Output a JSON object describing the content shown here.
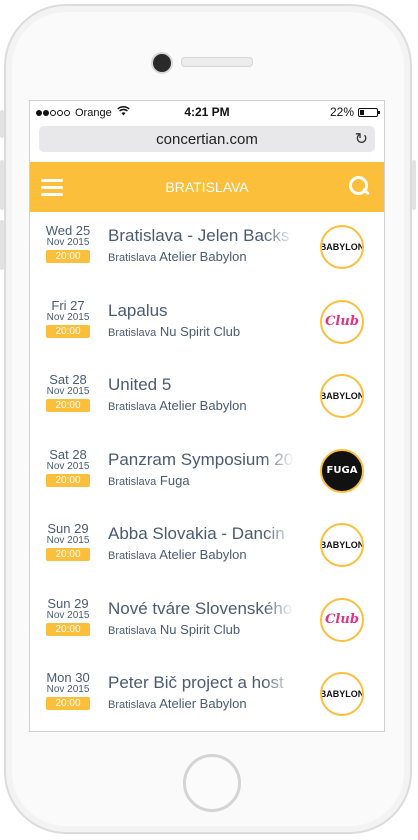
{
  "status_bar": {
    "carrier": "Orange",
    "time": "4:21 PM",
    "battery": "22%",
    "battery_level": 0.22,
    "wifi_icon": "wifi-icon"
  },
  "browser": {
    "url": "concertian.com",
    "reload_icon": "↻"
  },
  "app_bar": {
    "title": "BRATISLAVA",
    "menu_icon": "hamburger-icon",
    "search_icon": "search-icon",
    "accent_color": "#fbbf3b"
  },
  "events": [
    {
      "day": "Wed 25",
      "month": "Nov 2015",
      "time": "20:00",
      "title": "Bratislava - Jelen Backs",
      "city": "Bratislava",
      "venue": "Atelier Babylon",
      "logo": "BABYLON"
    },
    {
      "day": "Fri 27",
      "month": "Nov 2015",
      "time": "20:00",
      "title": "Lapalus",
      "city": "Bratislava",
      "venue": "Nu Spirit Club",
      "logo": "Club"
    },
    {
      "day": "Sat 28",
      "month": "Nov 2015",
      "time": "20:00",
      "title": "United 5",
      "city": "Bratislava",
      "venue": "Atelier Babylon",
      "logo": "BABYLON"
    },
    {
      "day": "Sat 28",
      "month": "Nov 2015",
      "time": "20:00",
      "title": "Panzram Symposium 20",
      "city": "Bratislava",
      "venue": "Fuga",
      "logo": "FUGA"
    },
    {
      "day": "Sun 29",
      "month": "Nov 2015",
      "time": "20:00",
      "title": "Abba Slovakia - Dancin",
      "city": "Bratislava",
      "venue": "Atelier Babylon",
      "logo": "BABYLON"
    },
    {
      "day": "Sun 29",
      "month": "Nov 2015",
      "time": "20:00",
      "title": "Nové tváre Slovenského",
      "city": "Bratislava",
      "venue": "Nu Spirit Club",
      "logo": "Club"
    },
    {
      "day": "Mon 30",
      "month": "Nov 2015",
      "time": "20:00",
      "title": "Peter Bič project a host",
      "city": "Bratislava",
      "venue": "Atelier Babylon",
      "logo": "BABYLON"
    }
  ]
}
